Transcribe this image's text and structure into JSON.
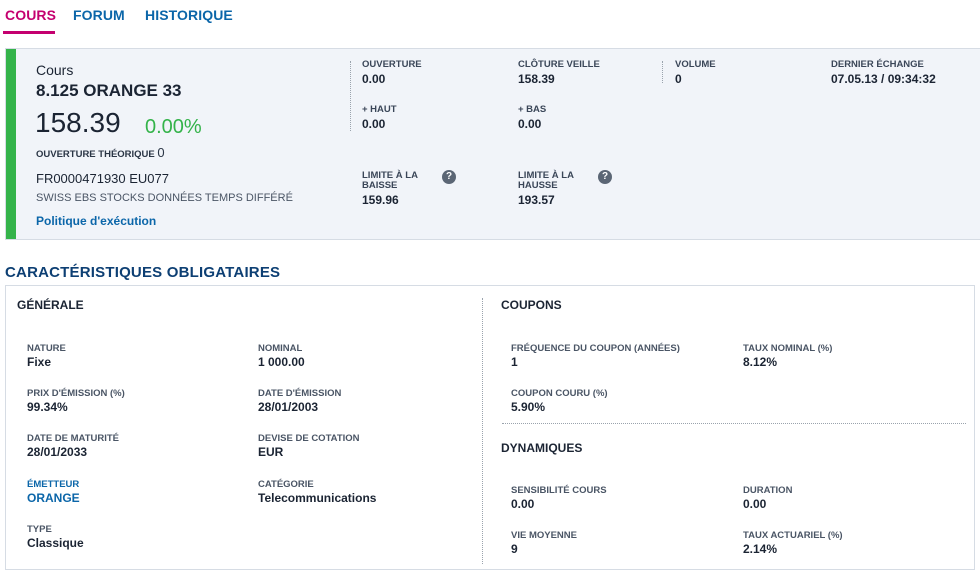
{
  "tabs": [
    {
      "label": "COURS",
      "active": true
    },
    {
      "label": "FORUM",
      "active": false
    },
    {
      "label": "HISTORIQUE",
      "active": false
    }
  ],
  "quote": {
    "label": "Cours",
    "name": "8.125 ORANGE 33",
    "price": "158.39",
    "change": "0.00%",
    "ouverture_theorique_label": "OUVERTURE THÉORIQUE",
    "ouverture_theorique_value": "0",
    "isin_market": "FR0000471930 EU077",
    "source": "SWISS EBS STOCKS DONNÉES TEMPS DIFFÉRÉ",
    "policy_link": "Politique d'exécution",
    "stats": {
      "ouverture": {
        "label": "OUVERTURE",
        "value": "0.00"
      },
      "cloture_veille": {
        "label": "CLÔTURE VEILLE",
        "value": "158.39"
      },
      "volume": {
        "label": "VOLUME",
        "value": "0"
      },
      "dernier_echange": {
        "label": "DERNIER ÉCHANGE",
        "value": "07.05.13 / 09:34:32"
      },
      "haut": {
        "label": "+ HAUT",
        "value": "0.00"
      },
      "bas": {
        "label": "+ BAS",
        "value": "0.00"
      },
      "limite_baisse": {
        "label": "LIMITE À LA BAISSE",
        "value": "159.96"
      },
      "limite_hausse": {
        "label": "LIMITE À LA HAUSSE",
        "value": "193.57"
      }
    },
    "help_glyph": "?",
    "accent_color": "#34b34a"
  },
  "characteristics": {
    "title": "CARACTÉRISTIQUES OBLIGATAIRES",
    "generale": {
      "heading": "GÉNÉRALE",
      "nature": {
        "label": "NATURE",
        "value": "Fixe"
      },
      "nominal": {
        "label": "NOMINAL",
        "value": "1 000.00"
      },
      "prix_emission": {
        "label": "PRIX D'ÉMISSION (%)",
        "value": "99.34%"
      },
      "date_emission": {
        "label": "DATE D'ÉMISSION",
        "value": "28/01/2003"
      },
      "date_maturite": {
        "label": "DATE DE MATURITÉ",
        "value": "28/01/2033"
      },
      "devise": {
        "label": "DEVISE DE COTATION",
        "value": "EUR"
      },
      "emetteur": {
        "label": "ÉMETTEUR",
        "value": "ORANGE"
      },
      "categorie": {
        "label": "CATÉGORIE",
        "value": "Telecommunications"
      },
      "type": {
        "label": "TYPE",
        "value": "Classique"
      }
    },
    "coupons": {
      "heading": "COUPONS",
      "frequence": {
        "label": "FRÉQUENCE DU COUPON (ANNÉES)",
        "value": "1"
      },
      "taux_nominal": {
        "label": "TAUX NOMINAL (%)",
        "value": "8.12%"
      },
      "coupon_couru": {
        "label": "COUPON COURU (%)",
        "value": "5.90%"
      }
    },
    "dynamiques": {
      "heading": "DYNAMIQUES",
      "sensibilite": {
        "label": "SENSIBILITÉ COURS",
        "value": "0.00"
      },
      "duration": {
        "label": "DURATION",
        "value": "0.00"
      },
      "vie_moyenne": {
        "label": "VIE MOYENNE",
        "value": "9"
      },
      "taux_actuariel": {
        "label": "TAUX ACTUARIEL (%)",
        "value": "2.14%"
      }
    }
  },
  "colors": {
    "active_tab": "#c4006f",
    "link": "#0b66a9",
    "title": "#0d3f73",
    "positive": "#34b34a"
  }
}
